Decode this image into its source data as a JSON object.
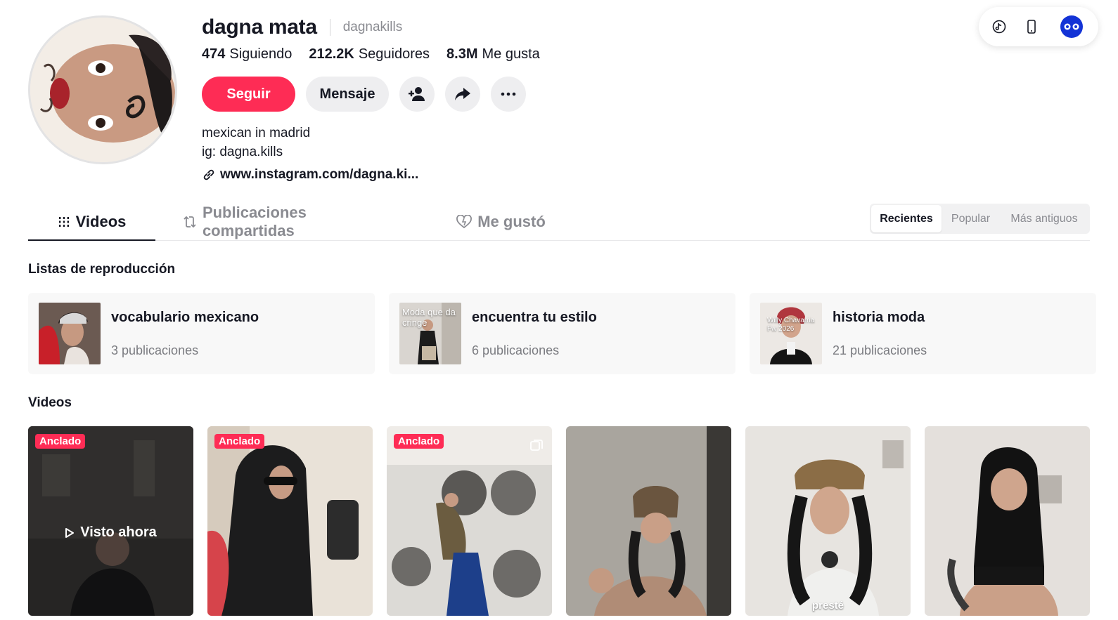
{
  "profile": {
    "display_name": "dagna mata",
    "handle": "dagnakills",
    "stats": [
      {
        "value": "474",
        "label": "Siguiendo"
      },
      {
        "value": "212.2K",
        "label": "Seguidores"
      },
      {
        "value": "8.3M",
        "label": "Me gusta"
      }
    ],
    "follow_label": "Seguir",
    "message_label": "Mensaje",
    "bio_lines": [
      "mexican in madrid",
      "ig: dagna.kills"
    ],
    "link": "www.instagram.com/dagna.ki..."
  },
  "tabs": [
    {
      "label": "Videos",
      "icon": "grid-icon",
      "active": true
    },
    {
      "label": "Publicaciones compartidas",
      "icon": "repost-icon",
      "active": false
    },
    {
      "label": "Me gustó",
      "icon": "heart-icon",
      "active": false
    }
  ],
  "sort": [
    "Recientes",
    "Popular",
    "Más antiguos"
  ],
  "playlists_title": "Listas de reproducción",
  "playlists": [
    {
      "title": "vocabulario mexicano",
      "count": "3 publicaciones"
    },
    {
      "title": "encuentra tu estilo",
      "count": "6 publicaciones",
      "thumb_text": "Moda que da cringe"
    },
    {
      "title": "historia moda",
      "count": "21 publicaciones",
      "thumb_text": "Willy Chavarria Fw 2026"
    }
  ],
  "videos_title": "Videos",
  "videos": [
    {
      "pinned_label": "Anclado",
      "watched_label": "Visto ahora"
    },
    {
      "pinned_label": "Anclado"
    },
    {
      "pinned_label": "Anclado"
    },
    {},
    {
      "caption": "presté"
    },
    {}
  ],
  "colors": {
    "accent": "#fe2c55",
    "text": "#161823",
    "muted": "#8a8b91"
  }
}
